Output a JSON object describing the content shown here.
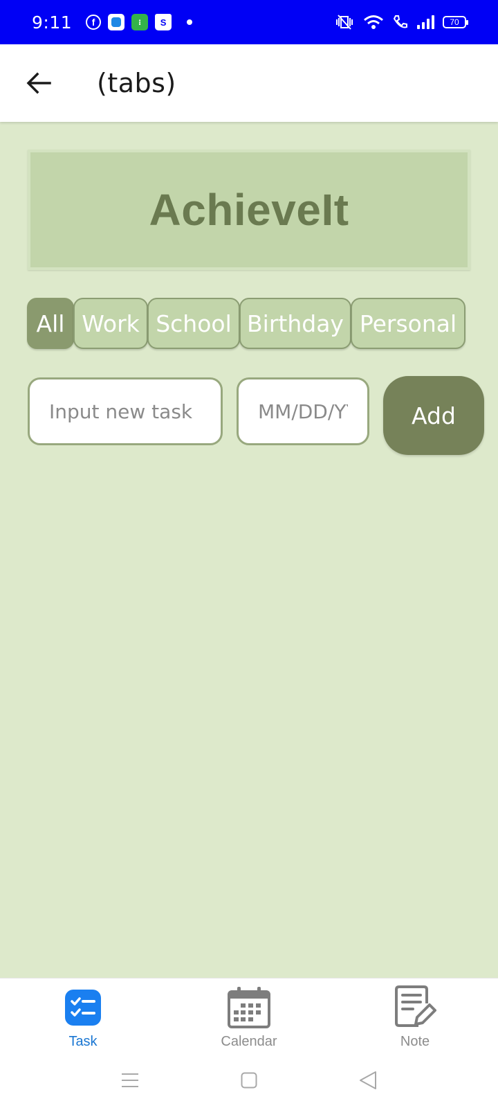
{
  "status_bar": {
    "time": "9:11",
    "battery": "70",
    "notification_icons": [
      "facebook-icon",
      "blue-app-icon",
      "green-app-icon",
      "shopping-bag-icon"
    ],
    "bg_color": "#0000f5"
  },
  "app_bar": {
    "title": "(tabs)"
  },
  "hero": {
    "title": "AchieveIt"
  },
  "tabs": [
    {
      "label": "All",
      "active": true
    },
    {
      "label": "Work",
      "active": false
    },
    {
      "label": "School",
      "active": false
    },
    {
      "label": "Birthday",
      "active": false
    },
    {
      "label": "Personal",
      "active": false
    }
  ],
  "form": {
    "task_placeholder": "Input new task",
    "date_placeholder": "MM/DD/YY",
    "add_label": "Add"
  },
  "bottom_nav": {
    "items": [
      {
        "label": "Task",
        "icon": "task-list-icon",
        "active": true
      },
      {
        "label": "Calendar",
        "icon": "calendar-icon",
        "active": false
      },
      {
        "label": "Note",
        "icon": "note-edit-icon",
        "active": false
      }
    ]
  },
  "colors": {
    "background": "#dde9cb",
    "hero_bg": "#c2d5aa",
    "hero_text": "#6a7a50",
    "tab_active": "#8a9a6e",
    "add_button": "#768259",
    "active_nav": "#1976d2"
  }
}
